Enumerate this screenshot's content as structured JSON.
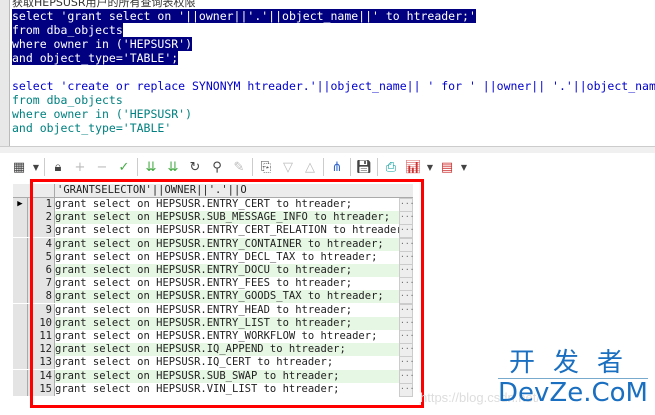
{
  "editor": {
    "comment": "获取HEPSUSR用户的所有查询表权限",
    "lines": [
      "select 'grant select on '||owner||'.'||object_name||' to htreader;'",
      "from dba_objects",
      "where owner in ('HEPSUSR')",
      "and object_type='TABLE';",
      "",
      "select 'create or replace SYNONYM htreader.'||object_name|| ' for ' ||owner|| '.'||object_name",
      "from dba_objects",
      "where owner in ('HEPSUSR')",
      "and object_type='TABLE'"
    ]
  },
  "toolbar": {
    "icons": [
      "grid-icon",
      "lock-icon",
      "plus-icon",
      "minus-icon",
      "check-icon",
      "chevron-down-double-icon",
      "chevron-down-double-icon",
      "refresh-icon",
      "binoculars-icon",
      "eraser-icon",
      "export-icon",
      "triangle-down-icon",
      "triangle-up-icon",
      "tree-icon",
      "save-icon",
      "print-icon",
      "bar-chart-icon",
      "table-icon"
    ]
  },
  "grid": {
    "column_header": "'GRANTSELECTON'||OWNER||'.'||O",
    "rows": [
      {
        "n": "1",
        "v": "grant select on HEPSUSR.ENTRY_CERT to htreader;"
      },
      {
        "n": "2",
        "v": "grant select on HEPSUSR.SUB_MESSAGE_INFO to htreader;"
      },
      {
        "n": "3",
        "v": "grant select on HEPSUSR.ENTRY_CERT_RELATION to htreader;"
      },
      {
        "n": "4",
        "v": "grant select on HEPSUSR.ENTRY_CONTAINER to htreader;"
      },
      {
        "n": "5",
        "v": "grant select on HEPSUSR.ENTRY_DECL_TAX to htreader;"
      },
      {
        "n": "6",
        "v": "grant select on HEPSUSR.ENTRY_DOCU to htreader;"
      },
      {
        "n": "7",
        "v": "grant select on HEPSUSR.ENTRY_FEES to htreader;"
      },
      {
        "n": "8",
        "v": "grant select on HEPSUSR.ENTRY_GOODS_TAX to htreader;"
      },
      {
        "n": "9",
        "v": "grant select on HEPSUSR.ENTRY_HEAD to htreader;"
      },
      {
        "n": "10",
        "v": "grant select on HEPSUSR.ENTRY_LIST to htreader;"
      },
      {
        "n": "11",
        "v": "grant select on HEPSUSR.ENTRY_WORKFLOW to htreader;"
      },
      {
        "n": "12",
        "v": "grant select on HEPSUSR.IQ_APPEND to htreader;"
      },
      {
        "n": "13",
        "v": "grant select on HEPSUSR.IQ_CERT to htreader;"
      },
      {
        "n": "14",
        "v": "grant select on HEPSUSR.SUB_SWAP to htreader;"
      },
      {
        "n": "15",
        "v": "grant select on HEPSUSR.VIN_LIST to htreader;"
      }
    ]
  },
  "watermark": "https://blog.csdn.net/",
  "logo": {
    "cn": "开发者",
    "en": "DevZe.CoM"
  },
  "colors": {
    "selection": "#000080",
    "keyword": "#008080",
    "string": "#0000cc",
    "highlight_box": "#ff0000",
    "alt_row": "#e6f7e3"
  }
}
